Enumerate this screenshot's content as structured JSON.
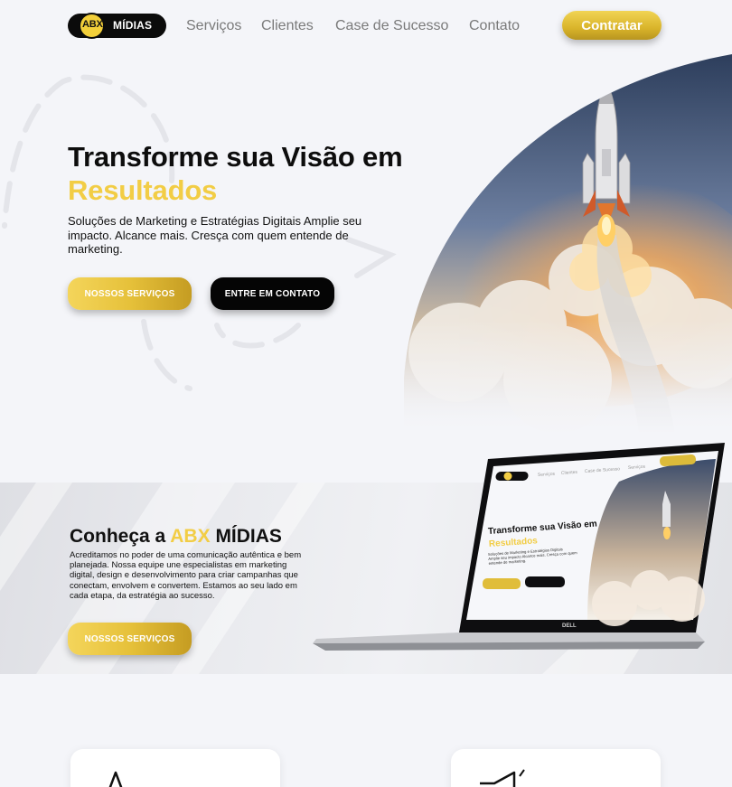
{
  "nav": {
    "logo": {
      "abx": "ABX",
      "midias": "MÍDIAS"
    },
    "links": [
      "Serviços",
      "Clientes",
      "Case de Sucesso",
      "Contato"
    ],
    "cta": "Contratar"
  },
  "hero": {
    "title_line1": "Transforme sua Visão em",
    "title_line2": "Resultados",
    "subtitle": "Soluções de Marketing e Estratégias Digitais Amplie seu impacto. Alcance mais. Cresça com quem entende de marketing.",
    "btn_services": "NOSSOS SERVIÇOS",
    "btn_contact": "ENTRE EM CONTATO"
  },
  "about": {
    "title_prefix": "Conheça a ",
    "title_accent": "ABX",
    "title_suffix": " MÍDIAS",
    "text": "Acreditamos no poder de uma comunicação autêntica e bem planejada. Nossa equipe une especialistas em marketing digital, design e desenvolvimento para criar campanhas que conectam, envolvem e convertem. Estamos ao seu lado em cada etapa, da estratégia ao sucesso.",
    "btn_services": "NOSSOS SERVIÇOS",
    "laptop_brand": "DELL",
    "screen": {
      "logo": "ABX MÍDIAS",
      "links": [
        "Serviços",
        "Clientes",
        "Case de Sucesso",
        "Serviços"
      ],
      "cta": "Contratar",
      "title_line1": "Transforme sua Visão em",
      "title_line2": "Resultados",
      "subtitle": "Soluções de Marketing e Estratégias Digitais Amplie seu impacto Alcance mais. Cresça com quem entende de marketing.",
      "btn_services": "NOSSOS SERVIÇOS",
      "btn_contact": "ENTRE EM CONTATO"
    }
  },
  "cards": [
    {
      "icon": "megaphone-icon"
    },
    {
      "icon": "megaphone-icon"
    }
  ],
  "colors": {
    "accent": "#f2cd45",
    "dark": "#0b0b0b",
    "background": "#f4f5f9"
  }
}
